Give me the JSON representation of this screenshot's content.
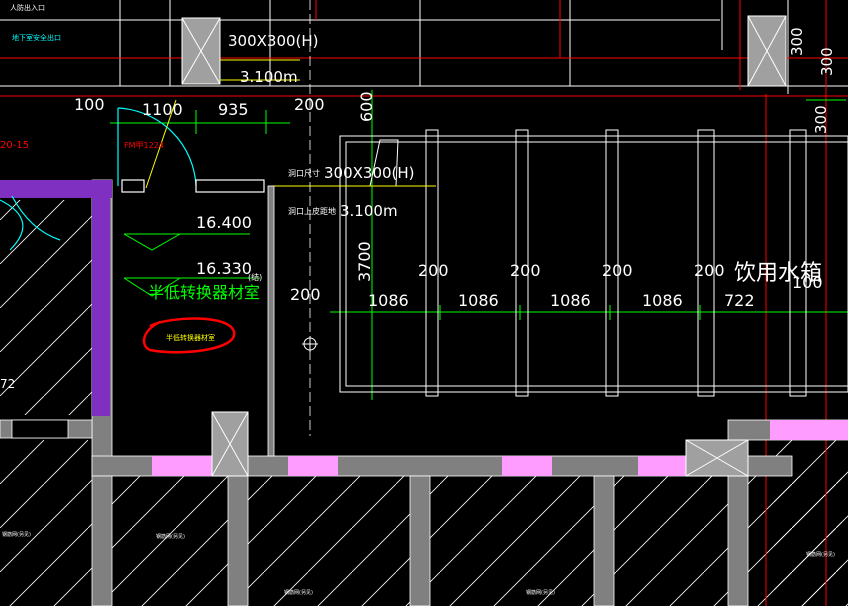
{
  "colors": {
    "background": "#000000",
    "dimension": "#ffffff",
    "dim_line": "#00ff00",
    "axis": "#ff0000",
    "wall": "#808080",
    "partition": "#ff80ff",
    "purple_wall": "#8030c0",
    "door": "#00ffff",
    "room_text": "#00ff00",
    "annotation": "#ffff00",
    "markup": "#ff0000",
    "tank": "#ffffff"
  },
  "labels": {
    "top_left_1": "人防出入口",
    "top_left_2": "地下室安全出口",
    "opening_size_top": "洞口尺寸300X300(H)",
    "opening_size_top_short": "300X300(H)",
    "opening_height_top": "洞口上皮距地3.100m",
    "opening_height_top_short": "3.100m",
    "opening_size_mid": "300X300(H)",
    "opening_size_mid_prefix": "洞口尺寸",
    "opening_height_mid_prefix": "洞口上皮距地",
    "opening_height_mid": "3.100m",
    "door_tag": "FM甲1224",
    "left_code": "20-15",
    "left_number": "72",
    "elev_1": "16.400",
    "elev_2": "16.330",
    "elev_note": "(结)",
    "room_name": "半低转换器材室",
    "markup_text": "半低转换器材室",
    "tank_name": "饮用水箱",
    "right_300_a": "300",
    "right_300_b": "300",
    "right_300_c": "300",
    "bottom_note_1": "钢筋网(另见)",
    "bottom_note_2": "钢筋网(另见)",
    "bottom_note_3": "钢筋网(另见)",
    "bottom_note_4": "钢筋网(另见)",
    "bottom_note_5": "钢筋网(另见)"
  },
  "dimensions": {
    "d100": "100",
    "d1100": "1100",
    "d935": "935",
    "d200_top": "200",
    "d600": "600",
    "d3700": "3700",
    "d200_mid": "200",
    "spacing": [
      "200",
      "200",
      "200",
      "200",
      "100"
    ],
    "bays": [
      "1086",
      "1086",
      "1086",
      "1086",
      "722"
    ]
  }
}
